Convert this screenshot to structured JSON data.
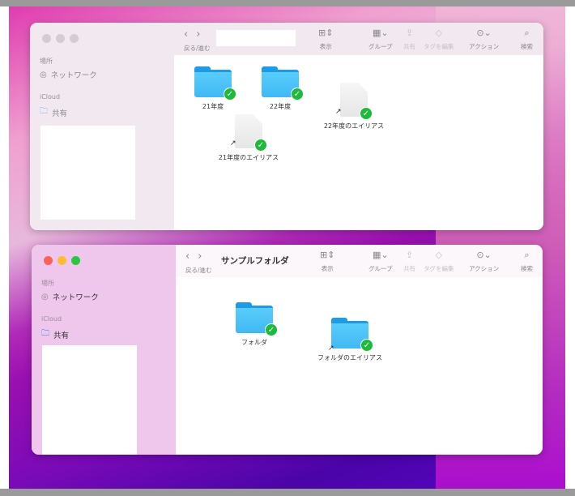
{
  "toolbar": {
    "nav_label": "戻る/進む",
    "view": "表示",
    "group": "グループ",
    "share": "共有",
    "tags": "タグを編集",
    "action": "アクション",
    "search": "検索"
  },
  "sidebar": {
    "places": "場所",
    "network": "ネットワーク",
    "icloud": "iCloud",
    "shared": "共有"
  },
  "window1": {
    "items": [
      "21年度",
      "22年度",
      "22年度のエイリアス",
      "21年度のエイリアス"
    ]
  },
  "window2": {
    "title": "サンプルフォルダ",
    "items": [
      "フォルダ",
      "フォルダのエイリアス"
    ]
  }
}
